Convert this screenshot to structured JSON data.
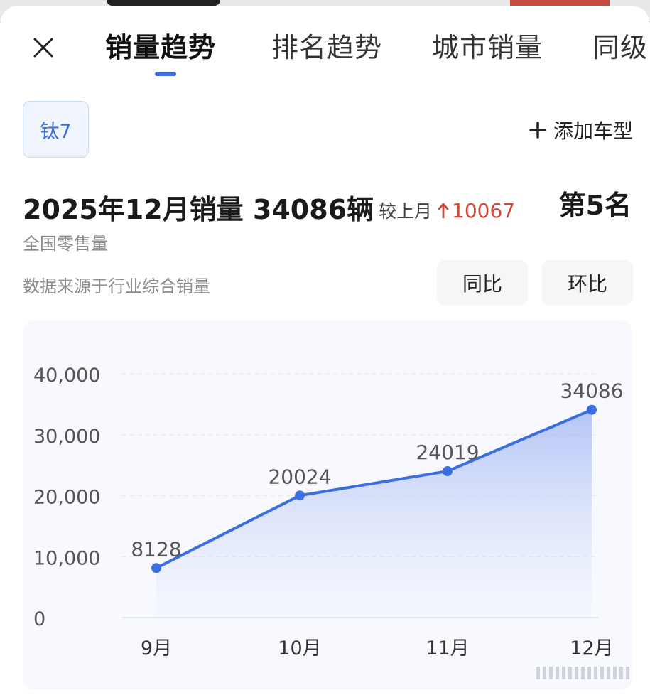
{
  "tabs": [
    {
      "label": "销量趋势",
      "active": true
    },
    {
      "label": "排名趋势",
      "active": false
    },
    {
      "label": "城市销量",
      "active": false
    },
    {
      "label": "同级",
      "active": false
    }
  ],
  "model_chip": "钛7",
  "add_model_label": "添加车型",
  "headline": "2025年12月销量 34086辆",
  "compare": {
    "label": "较上月",
    "delta": "10067"
  },
  "rank": "第5名",
  "scope_label": "全国零售量",
  "source_label": "数据来源于行业综合销量",
  "toggles": {
    "yoy": "同比",
    "mom": "环比"
  },
  "colors": {
    "accent": "#3b6fe0",
    "up": "#d04a3a"
  },
  "chart_data": {
    "type": "area",
    "categories": [
      "9月",
      "10月",
      "11月",
      "12月"
    ],
    "values": [
      8128,
      20024,
      24019,
      34086
    ],
    "y_ticks": [
      "0",
      "10,000",
      "20,000",
      "30,000",
      "40,000"
    ],
    "ylim": [
      0,
      40000
    ],
    "grid": true,
    "data_labels": [
      "8128",
      "20024",
      "24019",
      "34086"
    ],
    "series": [
      {
        "values": [
          8128,
          20024,
          24019,
          34086
        ],
        "color": "#3b6fe0"
      }
    ]
  }
}
